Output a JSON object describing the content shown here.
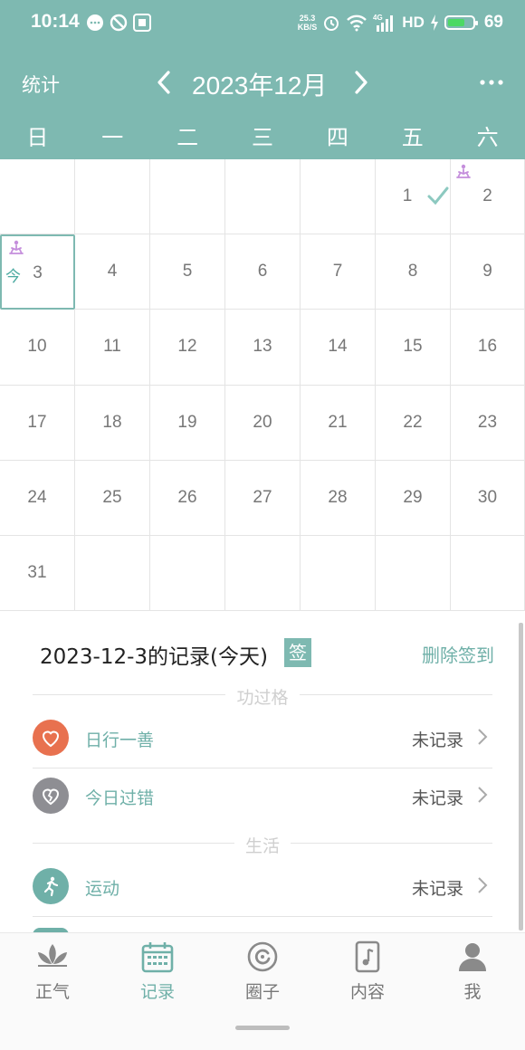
{
  "status_bar": {
    "time": "10:14",
    "net_speed_value": "25.3",
    "net_speed_unit": "KB/S",
    "network": "4G",
    "hd": "HD",
    "battery": "69",
    "battery_level": 0.69,
    "battery_color": "#4cd964",
    "icons": [
      "chat-bubble-icon",
      "block-icon",
      "sticker-icon",
      "alarm-icon",
      "wifi-icon",
      "signal-icon",
      "charging-icon",
      "battery-icon"
    ]
  },
  "header": {
    "stats_label": "统计",
    "month_title": "2023年12月",
    "prev_icon": "chevron-left-icon",
    "next_icon": "chevron-right-icon",
    "more_icon": "more-dots-icon",
    "background": "#7eb9b1"
  },
  "weekdays": [
    "日",
    "一",
    "二",
    "三",
    "四",
    "五",
    "六"
  ],
  "calendar": {
    "weeks": [
      [
        "",
        "",
        "",
        "",
        "",
        "1",
        "2"
      ],
      [
        "3",
        "4",
        "5",
        "6",
        "7",
        "8",
        "9"
      ],
      [
        "10",
        "11",
        "12",
        "13",
        "14",
        "15",
        "16"
      ],
      [
        "17",
        "18",
        "19",
        "20",
        "21",
        "22",
        "23"
      ],
      [
        "24",
        "25",
        "26",
        "27",
        "28",
        "29",
        "30"
      ],
      [
        "31",
        "",
        "",
        "",
        "",
        "",
        ""
      ]
    ],
    "today_label": "今",
    "today_date": "3",
    "checked_dates": [
      "1"
    ],
    "tagged_dates": [
      "2",
      "3"
    ],
    "tag_icon": "meditation-icon",
    "tag_color": "#c58fdc",
    "check_color": "#8cc9c0"
  },
  "records": {
    "title": "2023-12-3的记录(今天)",
    "sign_badge": "签",
    "delete_sign": "删除签到",
    "sections": [
      {
        "title": "功过格",
        "items": [
          {
            "label": "日行一善",
            "status": "未记录",
            "icon": "heart-icon",
            "color": "#e8714f"
          },
          {
            "label": "今日过错",
            "status": "未记录",
            "icon": "broken-heart-icon",
            "color": "#8e8e93"
          }
        ]
      },
      {
        "title": "生活",
        "items": [
          {
            "label": "运动",
            "status": "未记录",
            "icon": "running-icon",
            "color": "#6fb0a8"
          }
        ]
      }
    ]
  },
  "bottom_nav": {
    "items": [
      {
        "label": "正气",
        "icon": "lotus-icon",
        "active": false
      },
      {
        "label": "记录",
        "icon": "calendar-icon",
        "active": true
      },
      {
        "label": "圈子",
        "icon": "circle-refresh-icon",
        "active": false
      },
      {
        "label": "内容",
        "icon": "music-doc-icon",
        "active": false
      },
      {
        "label": "我",
        "icon": "person-icon",
        "active": false
      }
    ]
  }
}
